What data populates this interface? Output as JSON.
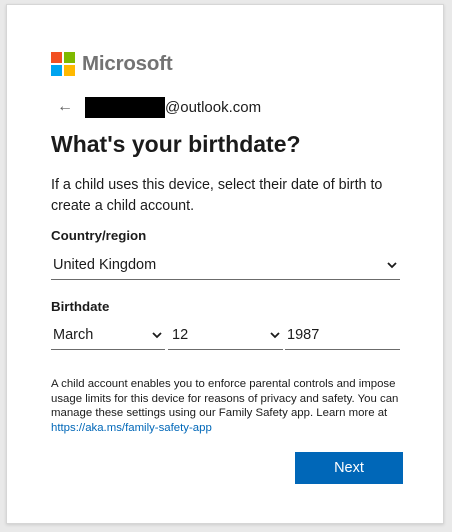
{
  "brand": {
    "name": "Microsoft",
    "logo_colors": [
      "#f25022",
      "#7fba00",
      "#00a4ef",
      "#ffb900"
    ]
  },
  "identity": {
    "back_icon": "arrow-left-icon",
    "email_suffix": "@outlook.com"
  },
  "page": {
    "title": "What's your birthdate?",
    "description": "If a child uses this device, select their date of birth to create a child account."
  },
  "country": {
    "label": "Country/region",
    "value": "United Kingdom"
  },
  "birthdate": {
    "label": "Birthdate",
    "month": "March",
    "day": "12",
    "year": "1987"
  },
  "info": {
    "text": "A child account enables you to enforce parental controls and impose usage limits for this device for reasons of privacy and safety. You can manage these settings using our Family Safety app. Learn more at ",
    "link": "https://aka.ms/family-safety-app"
  },
  "actions": {
    "next_label": "Next"
  },
  "colors": {
    "accent": "#0067b8"
  }
}
